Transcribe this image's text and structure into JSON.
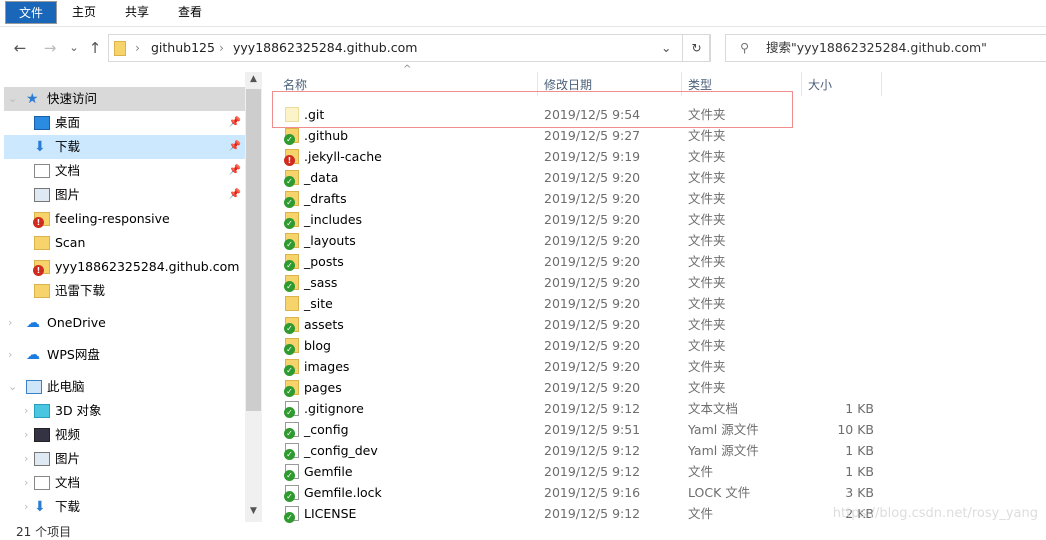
{
  "ribbon": {
    "tabs": [
      "文件",
      "主页",
      "共享",
      "查看"
    ]
  },
  "nav": {
    "back": "←",
    "forward": "→",
    "recent": "⌄",
    "up": "↑"
  },
  "address": {
    "segments": [
      "github125",
      "yyy18862325284.github.com"
    ],
    "refresh": "↻"
  },
  "search": {
    "placeholder": "搜索\"yyy18862325284.github.com\""
  },
  "columns": {
    "name": "名称",
    "date": "修改日期",
    "type": "类型",
    "size": "大小"
  },
  "sidebar": {
    "items": [
      {
        "label": "快速访问",
        "icon": "star-icon",
        "level": 0,
        "selected": true
      },
      {
        "label": "桌面",
        "icon": "desktop-icon",
        "level": 1,
        "pinned": true
      },
      {
        "label": "下载",
        "icon": "download-icon",
        "level": 1,
        "pinned": true,
        "active": true
      },
      {
        "label": "文档",
        "icon": "document-icon",
        "level": 1,
        "pinned": true
      },
      {
        "label": "图片",
        "icon": "picture-icon",
        "level": 1,
        "pinned": true
      },
      {
        "label": "feeling-responsive",
        "icon": "folder-error-icon",
        "level": 1
      },
      {
        "label": "Scan",
        "icon": "folder-icon",
        "level": 1
      },
      {
        "label": "yyy18862325284.github.com",
        "icon": "folder-error-icon",
        "level": 1
      },
      {
        "label": "迅雷下载",
        "icon": "folder-icon",
        "level": 1
      },
      {
        "label": "OneDrive",
        "icon": "cloud-icon",
        "level": 0
      },
      {
        "label": "WPS网盘",
        "icon": "cloud-icon",
        "level": 0
      },
      {
        "label": "此电脑",
        "icon": "computer-icon",
        "level": 0
      },
      {
        "label": "3D 对象",
        "icon": "cube-icon",
        "level": 1
      },
      {
        "label": "视频",
        "icon": "video-icon",
        "level": 1
      },
      {
        "label": "图片",
        "icon": "picture-icon",
        "level": 1
      },
      {
        "label": "文档",
        "icon": "document-icon",
        "level": 1
      },
      {
        "label": "下载",
        "icon": "download-icon",
        "level": 1
      }
    ]
  },
  "files": [
    {
      "name": ".git",
      "date": "2019/12/5 9:54",
      "type": "文件夹",
      "size": "",
      "icon": "folder-light",
      "status": "none"
    },
    {
      "name": ".github",
      "date": "2019/12/5 9:27",
      "type": "文件夹",
      "size": "",
      "icon": "folder",
      "status": "ok"
    },
    {
      "name": ".jekyll-cache",
      "date": "2019/12/5 9:19",
      "type": "文件夹",
      "size": "",
      "icon": "folder",
      "status": "error"
    },
    {
      "name": "_data",
      "date": "2019/12/5 9:20",
      "type": "文件夹",
      "size": "",
      "icon": "folder",
      "status": "ok"
    },
    {
      "name": "_drafts",
      "date": "2019/12/5 9:20",
      "type": "文件夹",
      "size": "",
      "icon": "folder",
      "status": "ok"
    },
    {
      "name": "_includes",
      "date": "2019/12/5 9:20",
      "type": "文件夹",
      "size": "",
      "icon": "folder",
      "status": "ok"
    },
    {
      "name": "_layouts",
      "date": "2019/12/5 9:20",
      "type": "文件夹",
      "size": "",
      "icon": "folder",
      "status": "ok"
    },
    {
      "name": "_posts",
      "date": "2019/12/5 9:20",
      "type": "文件夹",
      "size": "",
      "icon": "folder",
      "status": "ok"
    },
    {
      "name": "_sass",
      "date": "2019/12/5 9:20",
      "type": "文件夹",
      "size": "",
      "icon": "folder",
      "status": "ok"
    },
    {
      "name": "_site",
      "date": "2019/12/5 9:20",
      "type": "文件夹",
      "size": "",
      "icon": "folder",
      "status": "none"
    },
    {
      "name": "assets",
      "date": "2019/12/5 9:20",
      "type": "文件夹",
      "size": "",
      "icon": "folder",
      "status": "ok"
    },
    {
      "name": "blog",
      "date": "2019/12/5 9:20",
      "type": "文件夹",
      "size": "",
      "icon": "folder",
      "status": "ok"
    },
    {
      "name": "images",
      "date": "2019/12/5 9:20",
      "type": "文件夹",
      "size": "",
      "icon": "folder",
      "status": "ok"
    },
    {
      "name": "pages",
      "date": "2019/12/5 9:20",
      "type": "文件夹",
      "size": "",
      "icon": "folder",
      "status": "ok"
    },
    {
      "name": ".gitignore",
      "date": "2019/12/5 9:12",
      "type": "文本文档",
      "size": "1 KB",
      "icon": "file",
      "status": "ok"
    },
    {
      "name": "_config",
      "date": "2019/12/5 9:51",
      "type": "Yaml 源文件",
      "size": "10 KB",
      "icon": "file",
      "status": "ok"
    },
    {
      "name": "_config_dev",
      "date": "2019/12/5 9:12",
      "type": "Yaml 源文件",
      "size": "1 KB",
      "icon": "file",
      "status": "ok"
    },
    {
      "name": "Gemfile",
      "date": "2019/12/5 9:12",
      "type": "文件",
      "size": "1 KB",
      "icon": "file",
      "status": "ok"
    },
    {
      "name": "Gemfile.lock",
      "date": "2019/12/5 9:16",
      "type": "LOCK 文件",
      "size": "3 KB",
      "icon": "file",
      "status": "ok"
    },
    {
      "name": "LICENSE",
      "date": "2019/12/5 9:12",
      "type": "文件",
      "size": "2 KB",
      "icon": "file",
      "status": "ok"
    }
  ],
  "status": {
    "count": "21 个项目"
  },
  "watermark": "https://blog.csdn.net/rosy_yang",
  "colors": {
    "accent": "#1a66b8",
    "highlight": "#f08d8d",
    "ok": "#2f9a2f",
    "error": "#d02b1f"
  }
}
